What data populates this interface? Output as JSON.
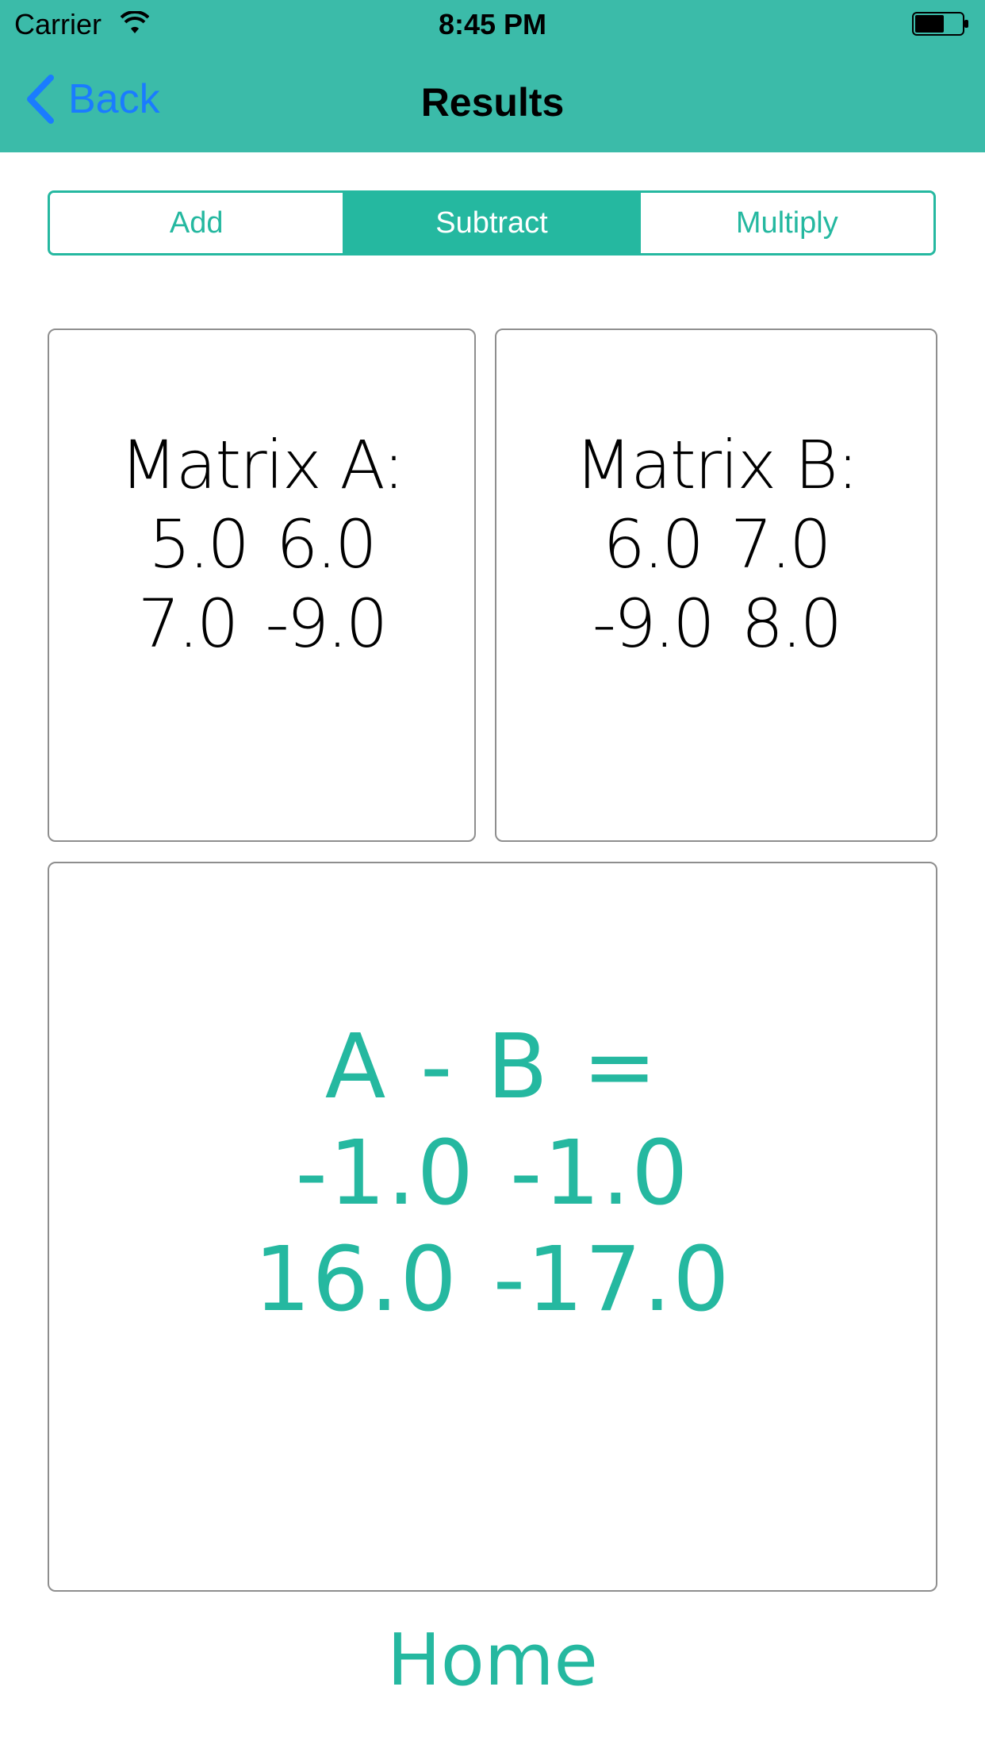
{
  "status_bar": {
    "carrier": "Carrier",
    "time": "8:45 PM"
  },
  "nav": {
    "back_label": "Back",
    "title": "Results"
  },
  "segments": [
    {
      "label": "Add",
      "selected": false
    },
    {
      "label": "Subtract",
      "selected": true
    },
    {
      "label": "Multiply",
      "selected": false
    }
  ],
  "matrix_a": {
    "title": "Matrix A:",
    "rows": [
      [
        "5.0",
        "6.0"
      ],
      [
        "7.0",
        "-9.0"
      ]
    ]
  },
  "matrix_b": {
    "title": "Matrix B:",
    "rows": [
      [
        "6.0",
        "7.0"
      ],
      [
        "-9.0",
        "8.0"
      ]
    ]
  },
  "result": {
    "title": "A - B =",
    "rows": [
      [
        "-1.0",
        "-1.0"
      ],
      [
        "16.0",
        "-17.0"
      ]
    ]
  },
  "home_label": "Home",
  "colors": {
    "header": "#3bbba9",
    "accent": "#25b8a0",
    "back_link": "#1a7cff"
  }
}
